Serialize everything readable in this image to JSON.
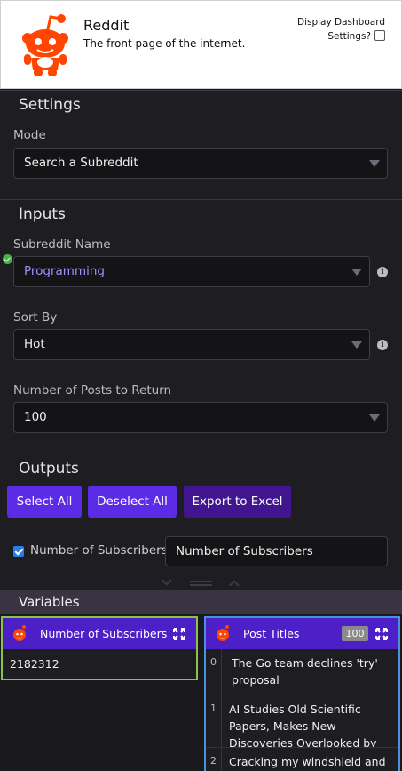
{
  "header": {
    "title": "Reddit",
    "subtitle": "The front page of the internet.",
    "dashboard_label": "Display Dashboard Settings?"
  },
  "settings": {
    "title": "Settings",
    "mode_label": "Mode",
    "mode_value": "Search a Subreddit"
  },
  "inputs": {
    "title": "Inputs",
    "subreddit_label": "Subreddit Name",
    "subreddit_value": "Programming",
    "sort_label": "Sort By",
    "sort_value": "Hot",
    "count_label": "Number of Posts to Return",
    "count_value": "100"
  },
  "outputs": {
    "title": "Outputs",
    "select_all": "Select All",
    "deselect_all": "Deselect All",
    "export": "Export to Excel",
    "checkbox_label": "Number of Subscribers",
    "output_name": "Number of Subscribers"
  },
  "variables": {
    "title": "Variables",
    "subscribers_card": {
      "title": "Number of Subscribers",
      "value": "2182312"
    },
    "posts_card": {
      "title": "Post Titles",
      "count": "100",
      "rows": [
        {
          "index": "0",
          "text": "The Go team declines 'try' proposal"
        },
        {
          "index": "1",
          "text": "AI Studies Old Scientific Papers, Makes New Discoveries Overlooked by Humans"
        },
        {
          "index": "2",
          "text": "Cracking my windshield and"
        }
      ]
    }
  },
  "colors": {
    "accent": "#5b2be6",
    "accent_dark": "#40158f",
    "card_header": "#4c1fc7",
    "success": "#49b34b",
    "subscribers_border": "#8bc34a",
    "posts_border": "#4a90e2",
    "reddit_orange": "#ff4500"
  },
  "icons": {
    "logo": "reddit-alien-icon",
    "valid": "check-circle-icon",
    "info": "info-icon",
    "expand": "expand-icon"
  }
}
